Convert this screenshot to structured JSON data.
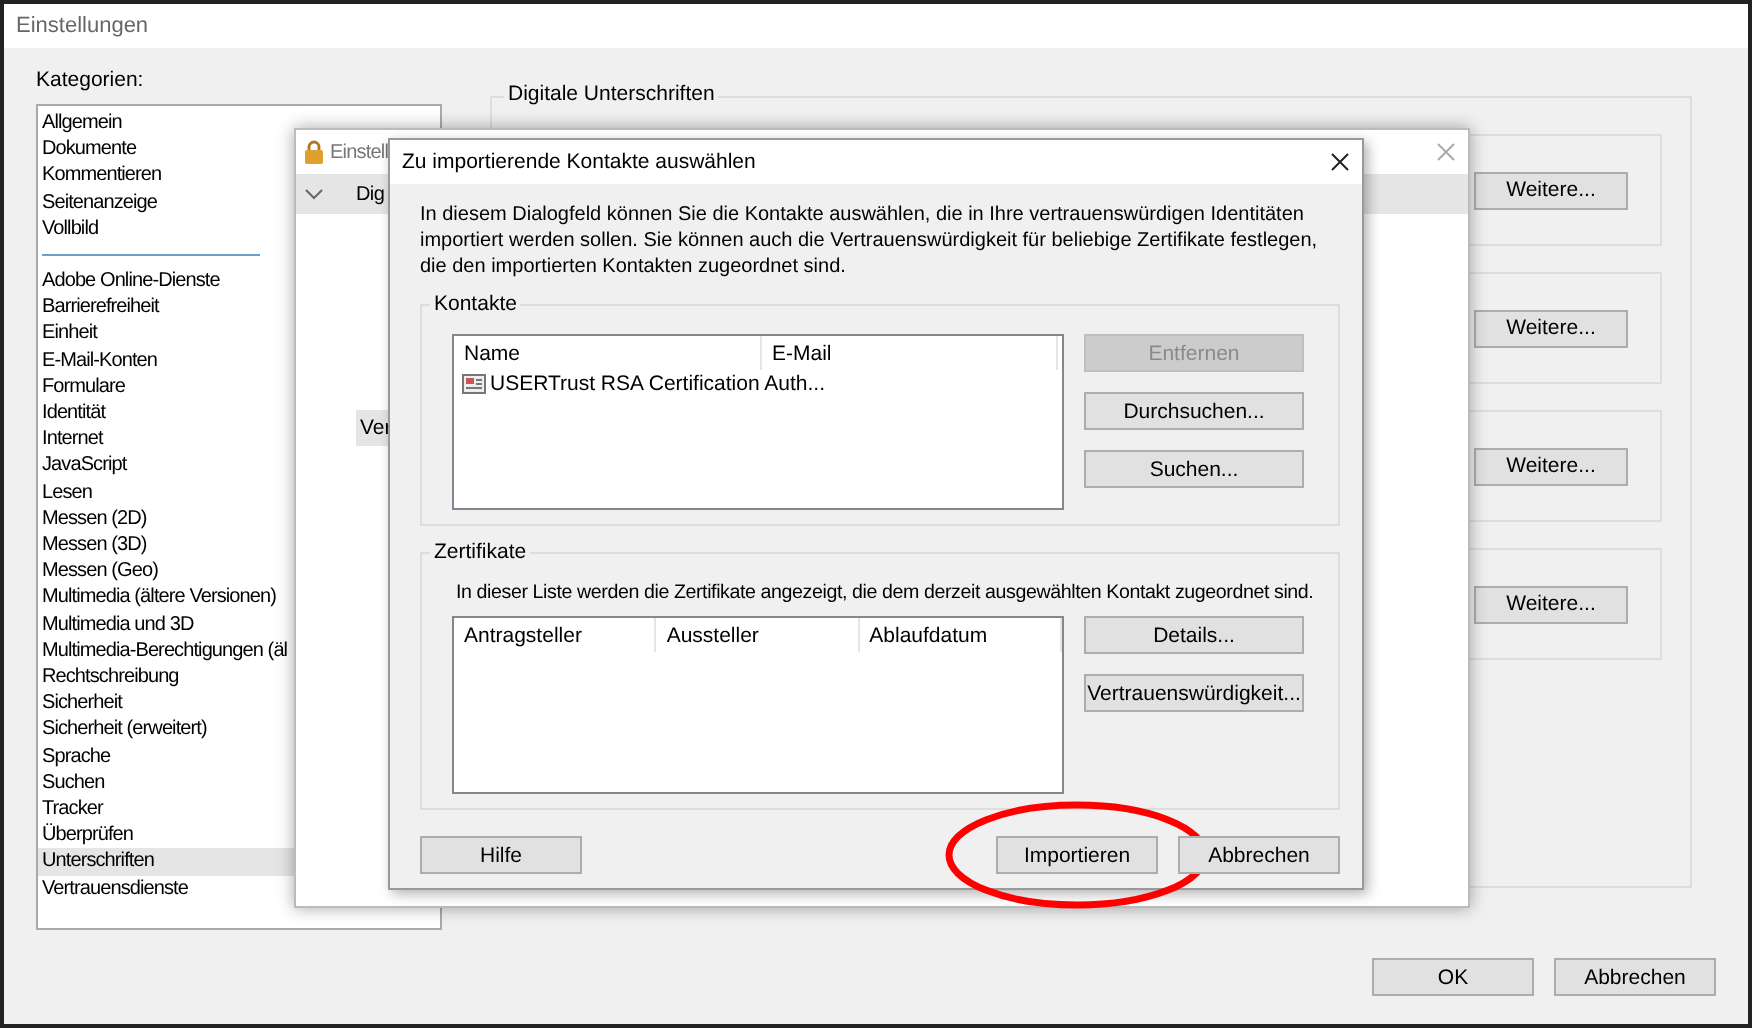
{
  "window": {
    "title": "Einstellungen",
    "categories_label": "Kategorien:",
    "category_groups": [
      [
        {
          "label": "Allgemein",
          "selected": false
        },
        {
          "label": "Dokumente",
          "selected": false
        },
        {
          "label": "Kommentieren",
          "selected": false
        },
        {
          "label": "Seitenanzeige",
          "selected": false
        },
        {
          "label": "Vollbild",
          "selected": false
        }
      ],
      [
        {
          "label": "Adobe Online-Dienste",
          "selected": false
        },
        {
          "label": "Barrierefreiheit",
          "selected": false
        },
        {
          "label": "Einheit",
          "selected": false
        },
        {
          "label": "E-Mail-Konten",
          "selected": false
        },
        {
          "label": "Formulare",
          "selected": false
        },
        {
          "label": "Identität",
          "selected": false
        },
        {
          "label": "Internet",
          "selected": false
        },
        {
          "label": "JavaScript",
          "selected": false
        },
        {
          "label": "Lesen",
          "selected": false
        },
        {
          "label": "Messen (2D)",
          "selected": false
        },
        {
          "label": "Messen (3D)",
          "selected": false
        },
        {
          "label": "Messen (Geo)",
          "selected": false
        },
        {
          "label": "Multimedia (ältere Versionen)",
          "selected": false
        },
        {
          "label": "Multimedia und 3D",
          "selected": false
        },
        {
          "label": "Multimedia-Berechtigungen (äl",
          "selected": false
        },
        {
          "label": "Rechtschreibung",
          "selected": false
        },
        {
          "label": "Sicherheit",
          "selected": false
        },
        {
          "label": "Sicherheit (erweitert)",
          "selected": false
        },
        {
          "label": "Sprache",
          "selected": false
        },
        {
          "label": "Suchen",
          "selected": false
        },
        {
          "label": "Tracker",
          "selected": false
        },
        {
          "label": "Überprüfen",
          "selected": false
        },
        {
          "label": "Unterschriften",
          "selected": true
        },
        {
          "label": "Vertrauensdienste",
          "selected": false
        }
      ]
    ],
    "section": {
      "title": "Digitale Unterschriften",
      "buttons": [
        "Weitere...",
        "Weitere...",
        "Weitere...",
        "Weitere..."
      ]
    },
    "buttons": [
      "OK",
      "Abbrechen"
    ]
  },
  "background_window": {
    "title": "Einstell",
    "items": [
      {
        "label": "Dig",
        "selected": false
      },
      {
        "label": "Ver",
        "selected": true
      }
    ]
  },
  "dialog": {
    "title": "Zu importierende Kontakte auswählen",
    "description": "In diesem Dialogfeld können Sie die Kontakte auswählen, die in Ihre vertrauenswürdigen Identitäten importiert werden sollen. Sie können auch die Vertrauenswürdigkeit für beliebige Zertifikate festlegen, die den importierten Kontakten zugeordnet sind.",
    "contacts": {
      "title": "Kontakte",
      "columns": [
        "Name",
        "E-Mail"
      ],
      "rows": [
        {
          "name": "USERTrust RSA Certification Auth..."
        }
      ],
      "buttons": [
        {
          "label": "Entfernen",
          "disabled": true
        },
        {
          "label": "Durchsuchen...",
          "disabled": false
        },
        {
          "label": "Suchen...",
          "disabled": false
        }
      ]
    },
    "certificates": {
      "title": "Zertifikate",
      "description": "In dieser Liste werden die Zertifikate angezeigt, die dem derzeit ausgewählten Kontakt zugeordnet sind.",
      "columns": [
        "Antragsteller",
        "Aussteller",
        "Ablaufdatum"
      ],
      "buttons": [
        {
          "label": "Details...",
          "disabled": false
        },
        {
          "label": "Vertrauenswürdigkeit...",
          "disabled": false
        }
      ]
    },
    "help_button": "Hilfe",
    "buttons": [
      "Importieren",
      "Abbrechen"
    ],
    "import_button_circled": true
  }
}
